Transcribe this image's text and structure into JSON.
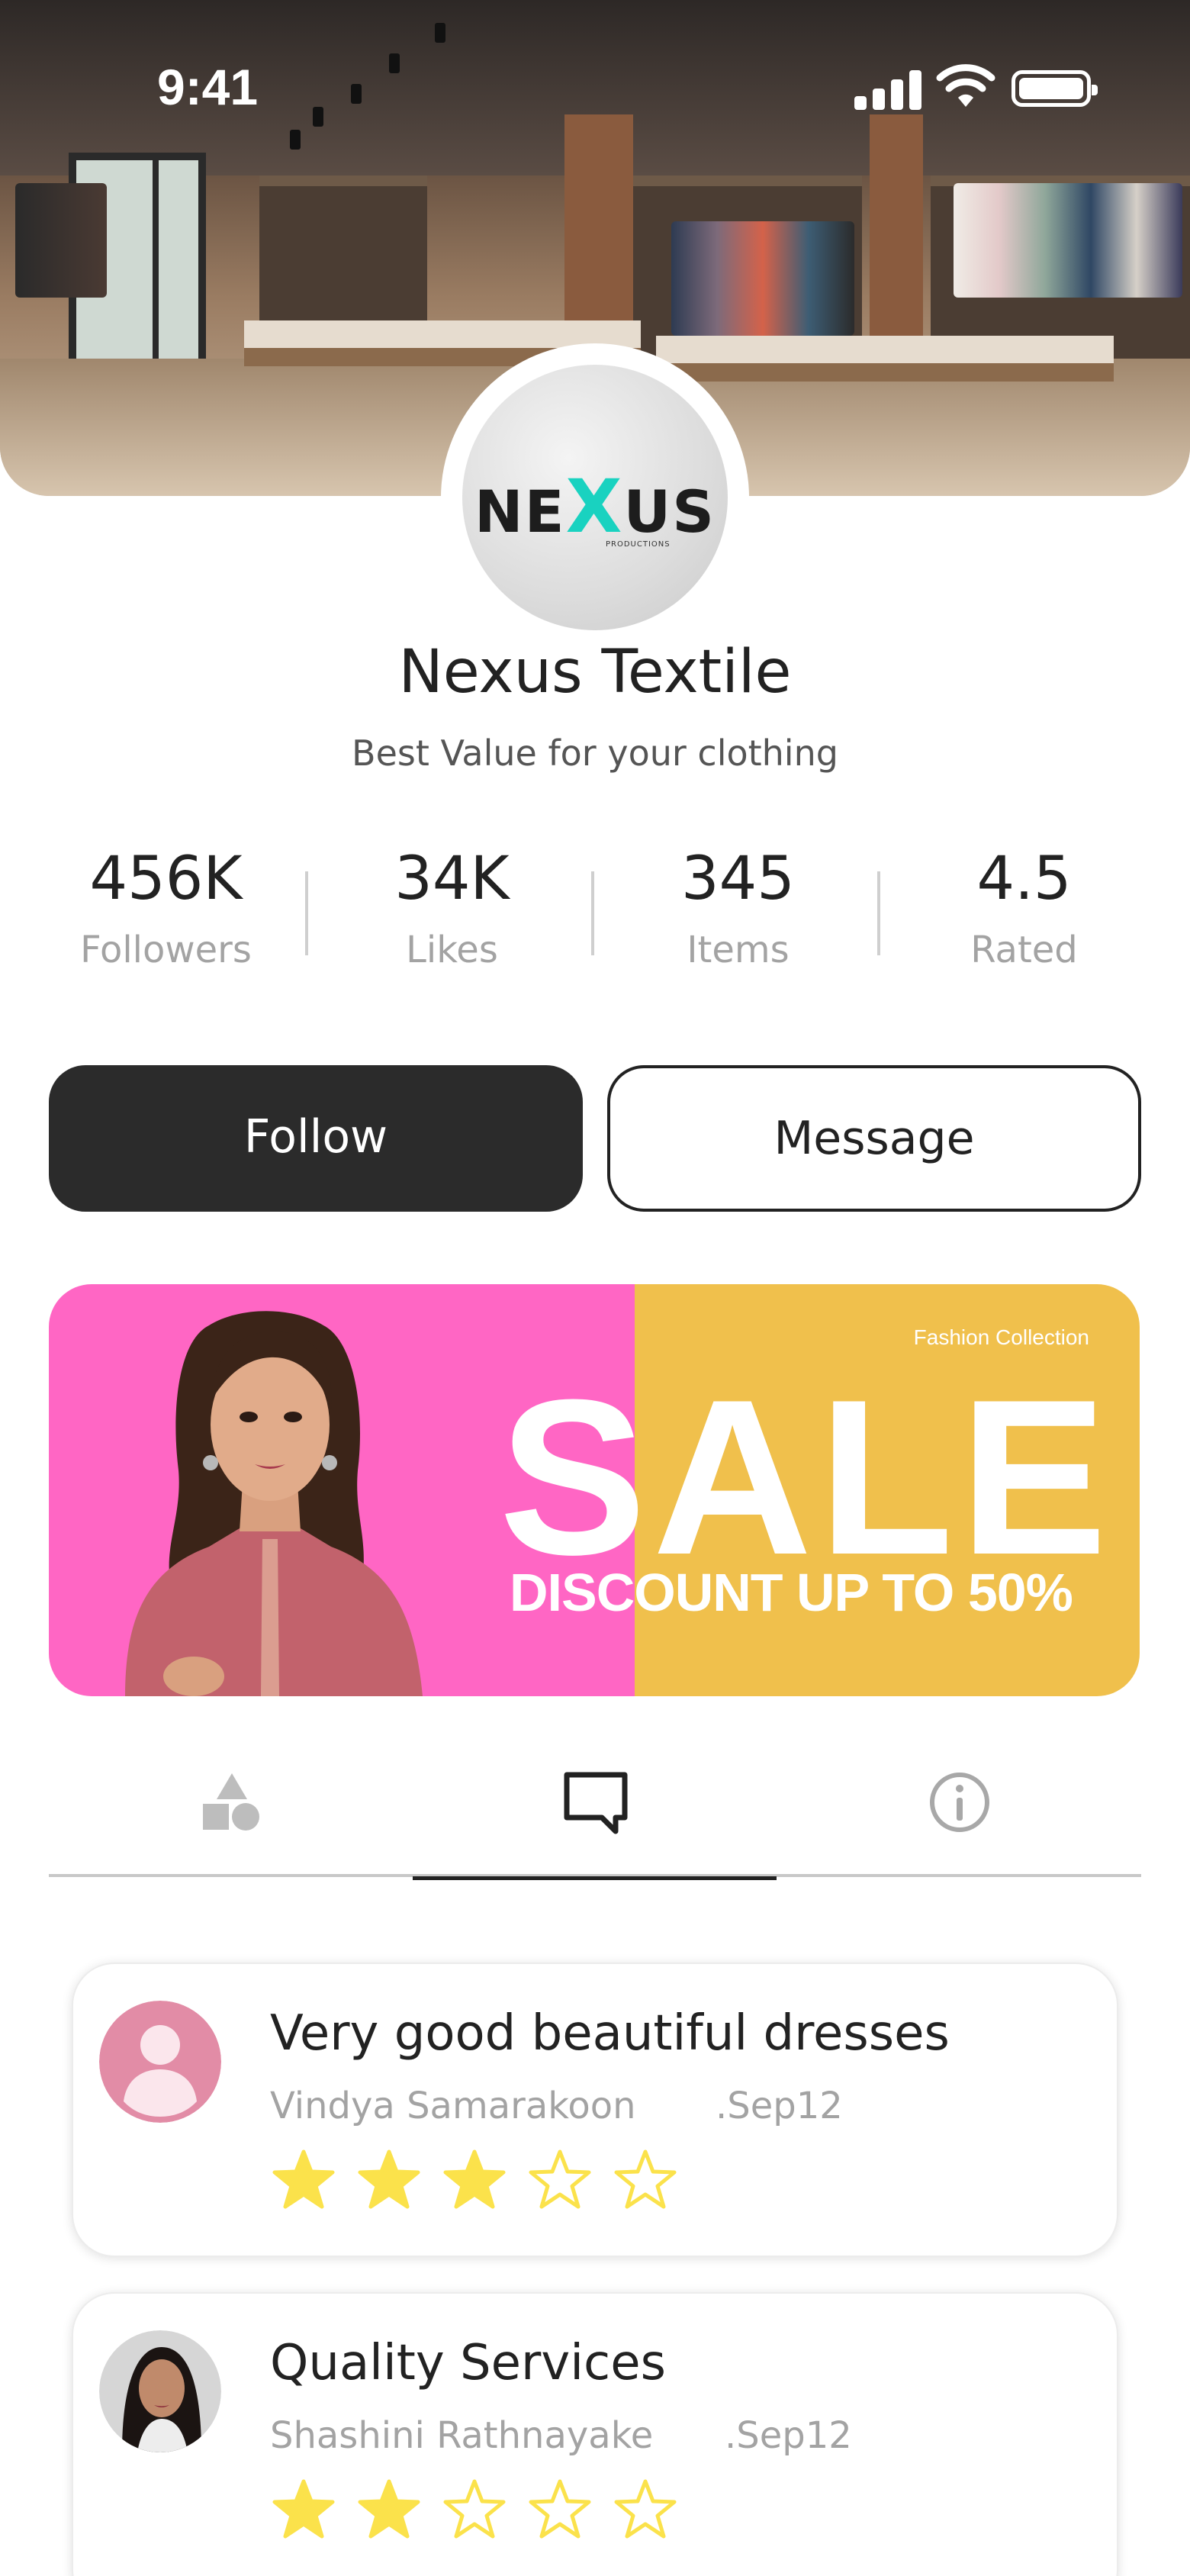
{
  "status_bar": {
    "time": "9:41"
  },
  "store": {
    "name": "Nexus Textile",
    "tagline": "Best Value for your clothing",
    "logo": {
      "text_before": "NE",
      "text_x": "X",
      "text_after": "US",
      "subtext": "PRODUCTIONS",
      "accent_color": "#19d2c0"
    }
  },
  "stats": [
    {
      "value": "456K",
      "label": "Followers"
    },
    {
      "value": "34K",
      "label": "Likes"
    },
    {
      "value": "345",
      "label": "Items"
    },
    {
      "value": "4.5",
      "label": "Rated"
    }
  ],
  "actions": {
    "follow_label": "Follow",
    "message_label": "Message"
  },
  "banner": {
    "collection": "Fashion Collection",
    "headline": "SALE",
    "subline": "DISCOUNT UP TO 50%",
    "colors": {
      "left": "#ff66c4",
      "right": "#f0c04c"
    }
  },
  "tabs": [
    {
      "icon": "shapes-icon",
      "active": false
    },
    {
      "icon": "comment-icon",
      "active": true
    },
    {
      "icon": "info-icon",
      "active": false
    }
  ],
  "reviews": [
    {
      "title": "Very good beautiful dresses",
      "author": "Vindya Samarakoon",
      "date": ".Sep12",
      "rating": 3,
      "max_rating": 5
    },
    {
      "title": "Quality Services",
      "author": "Shashini Rathnayake",
      "date": ".Sep12",
      "rating": 2,
      "max_rating": 5
    }
  ],
  "colors": {
    "star": "#fbe24b",
    "dark_button": "#2b2b2b",
    "muted_text": "#a3a3a3"
  }
}
